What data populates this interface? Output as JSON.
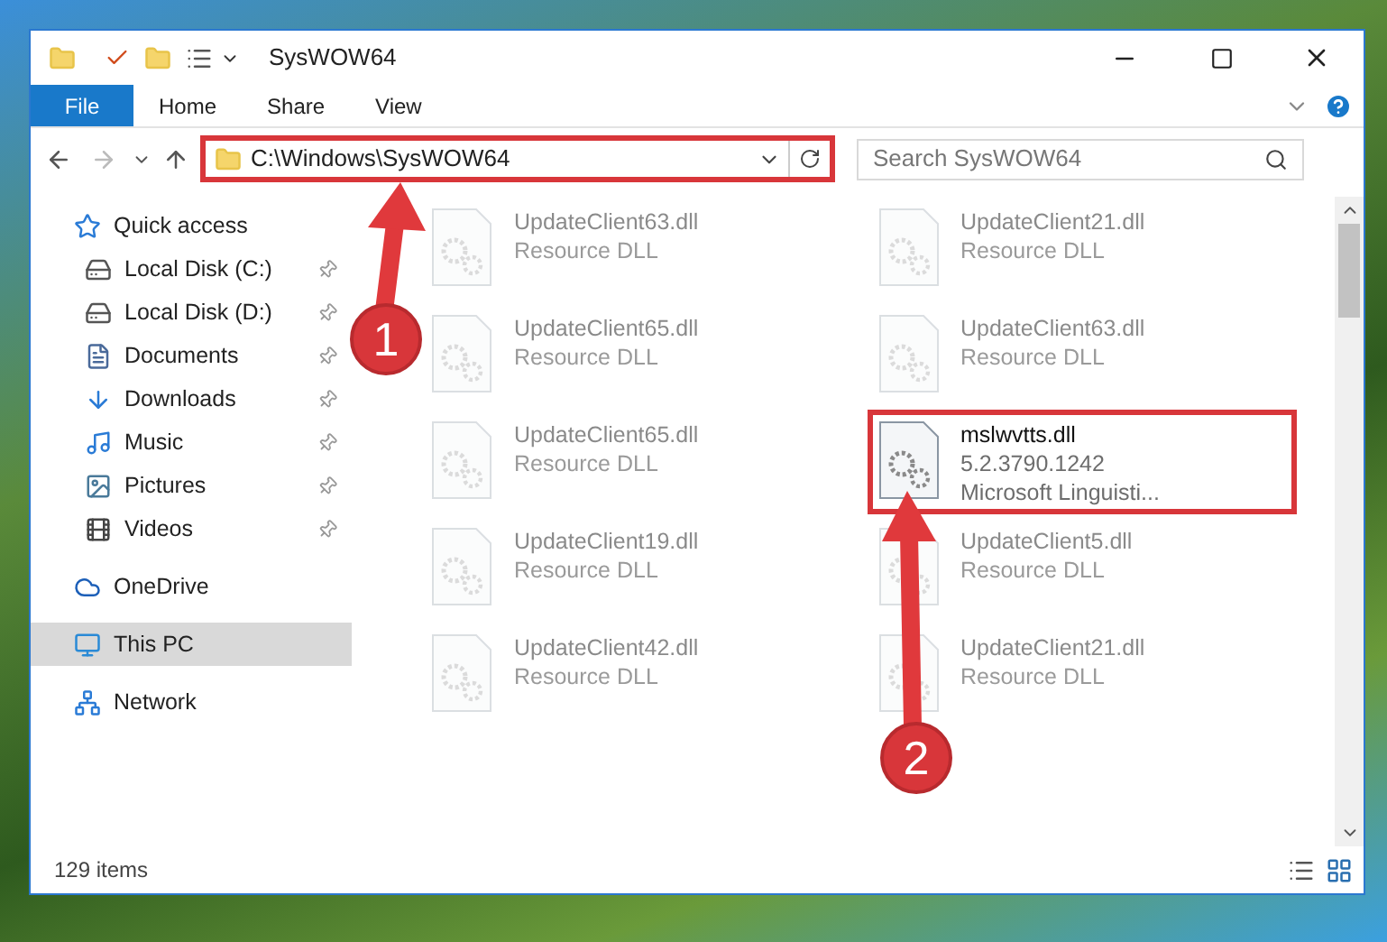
{
  "window": {
    "title": "SysWOW64"
  },
  "ribbon": {
    "tabs": [
      {
        "label": "File",
        "kind": "file"
      },
      {
        "label": "Home",
        "kind": "tab"
      },
      {
        "label": "Share",
        "kind": "tab"
      },
      {
        "label": "View",
        "kind": "tab"
      }
    ]
  },
  "address_bar": {
    "path": "C:\\Windows\\SysWOW64",
    "annotated": true
  },
  "search": {
    "placeholder": "Search SysWOW64"
  },
  "sidebar": {
    "items": [
      {
        "label": "Quick access",
        "kind": "star",
        "selected": false,
        "children": [
          {
            "label": "Local Disk (C:)",
            "kind": "drive",
            "pinned": true
          },
          {
            "label": "Local Disk (D:)",
            "kind": "drive",
            "pinned": true
          },
          {
            "label": "Documents",
            "kind": "doc",
            "pinned": true
          },
          {
            "label": "Downloads",
            "kind": "download",
            "pinned": true
          },
          {
            "label": "Music",
            "kind": "music",
            "pinned": true
          },
          {
            "label": "Pictures",
            "kind": "picture",
            "pinned": true
          },
          {
            "label": "Videos",
            "kind": "video",
            "pinned": true
          }
        ]
      },
      {
        "label": "OneDrive",
        "kind": "cloud",
        "selected": false
      },
      {
        "label": "This PC",
        "kind": "pc",
        "selected": true
      },
      {
        "label": "Network",
        "kind": "network",
        "selected": false
      }
    ]
  },
  "files": [
    {
      "name": "UpdateClient63.dll",
      "details": [
        "Resource DLL"
      ],
      "faded": true,
      "annotated": false
    },
    {
      "name": "UpdateClient21.dll",
      "details": [
        "Resource DLL"
      ],
      "faded": true,
      "annotated": false
    },
    {
      "name": "UpdateClient65.dll",
      "details": [
        "Resource DLL"
      ],
      "faded": true,
      "annotated": false
    },
    {
      "name": "UpdateClient63.dll",
      "details": [
        "Resource DLL"
      ],
      "faded": true,
      "annotated": false
    },
    {
      "name": "UpdateClient65.dll",
      "details": [
        "Resource DLL"
      ],
      "faded": true,
      "annotated": false
    },
    {
      "name": "mslwvtts.dll",
      "details": [
        "5.2.3790.1242",
        "Microsoft Linguisti..."
      ],
      "faded": false,
      "annotated": true
    },
    {
      "name": "UpdateClient19.dll",
      "details": [
        "Resource DLL"
      ],
      "faded": true,
      "annotated": false
    },
    {
      "name": "UpdateClient5.dll",
      "details": [
        "Resource DLL"
      ],
      "faded": true,
      "annotated": false
    },
    {
      "name": "UpdateClient42.dll",
      "details": [
        "Resource DLL"
      ],
      "faded": true,
      "annotated": false
    },
    {
      "name": "UpdateClient21.dll",
      "details": [
        "Resource DLL"
      ],
      "faded": true,
      "annotated": false
    }
  ],
  "status_bar": {
    "count": "129 items"
  },
  "callouts": [
    {
      "label": "1"
    },
    {
      "label": "2"
    }
  ]
}
